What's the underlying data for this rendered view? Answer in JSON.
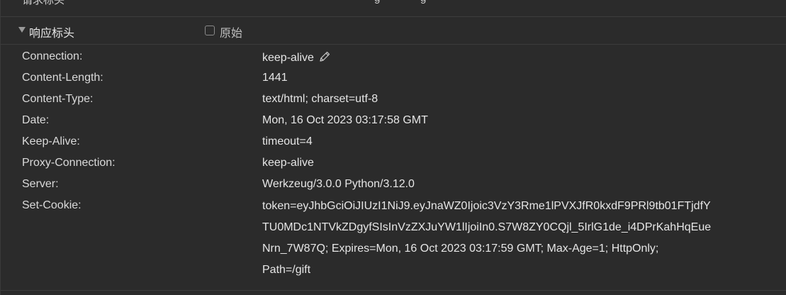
{
  "top_strip": {
    "cut_text_left": "请求标头",
    "cut_text_mid": "g",
    "cut_text_right": "g"
  },
  "section": {
    "title": "响应标头",
    "raw_label": "原始",
    "raw_checked": false
  },
  "headers": [
    {
      "name": "Connection:",
      "value": "keep-alive"
    },
    {
      "name": "Content-Length:",
      "value": "1441"
    },
    {
      "name": "Content-Type:",
      "value": "text/html; charset=utf-8"
    },
    {
      "name": "Date:",
      "value": "Mon, 16 Oct 2023 03:17:58 GMT"
    },
    {
      "name": "Keep-Alive:",
      "value": "timeout=4"
    },
    {
      "name": "Proxy-Connection:",
      "value": "keep-alive"
    },
    {
      "name": "Server:",
      "value": "Werkzeug/3.0.0 Python/3.12.0"
    }
  ],
  "set_cookie": {
    "name": "Set-Cookie:",
    "lines": [
      "token=eyJhbGciOiJIUzI1NiJ9.eyJnaWZ0Ijoic3VzY3Rme1lPVXJfR0kxdF9PRl9tb01FTjdfY",
      "TU0MDc1NTVkZDgyfSIsInVzZXJuYW1lIjoiIn0.S7W8ZY0CQjl_5IrlG1de_i4DPrKahHqEue",
      "Nrn_7W87Q; Expires=Mon, 16 Oct 2023 03:17:59 GMT; Max-Age=1; HttpOnly;",
      "Path=/gift"
    ]
  },
  "icons": {
    "edit": "pencil-icon",
    "expand": "triangle-down-icon"
  },
  "colors": {
    "background": "#2b2b2b",
    "divider": "#3c3c3c",
    "text": "#e3e3e3"
  }
}
